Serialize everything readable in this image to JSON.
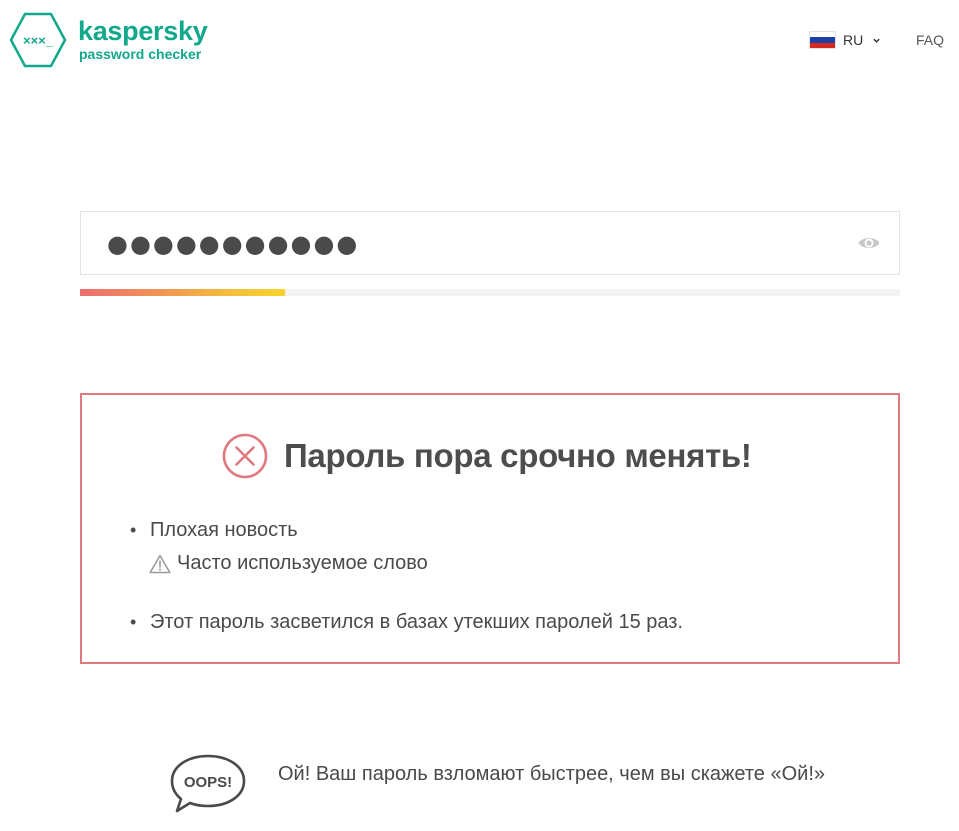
{
  "header": {
    "logo_badge_text": "×××_",
    "brand": "kaspersky",
    "subtitle": "password checker",
    "language_code": "RU",
    "faq_label": "FAQ",
    "flag_colors": [
      "#ffffff",
      "#1c3fa8",
      "#d52b1e"
    ]
  },
  "password": {
    "value": "●●●●●●●●●●●",
    "toggle_icon": "eye-icon",
    "strength_fraction": 0.25
  },
  "result": {
    "status_icon": "x-circle-icon",
    "title": "Пароль пора срочно менять!",
    "bullets": [
      "Плохая новость",
      "Этот пароль засветился в базах утекших паролей 15 раз."
    ],
    "warning": "Часто используемое слово"
  },
  "oops": {
    "badge": "OOPS!",
    "text": "Ой! Ваш пароль взломают быстрее, чем вы скажете «Ой!»"
  },
  "colors": {
    "brand": "#11a88b",
    "danger": "#e07a80",
    "text": "#4a4a4a"
  }
}
